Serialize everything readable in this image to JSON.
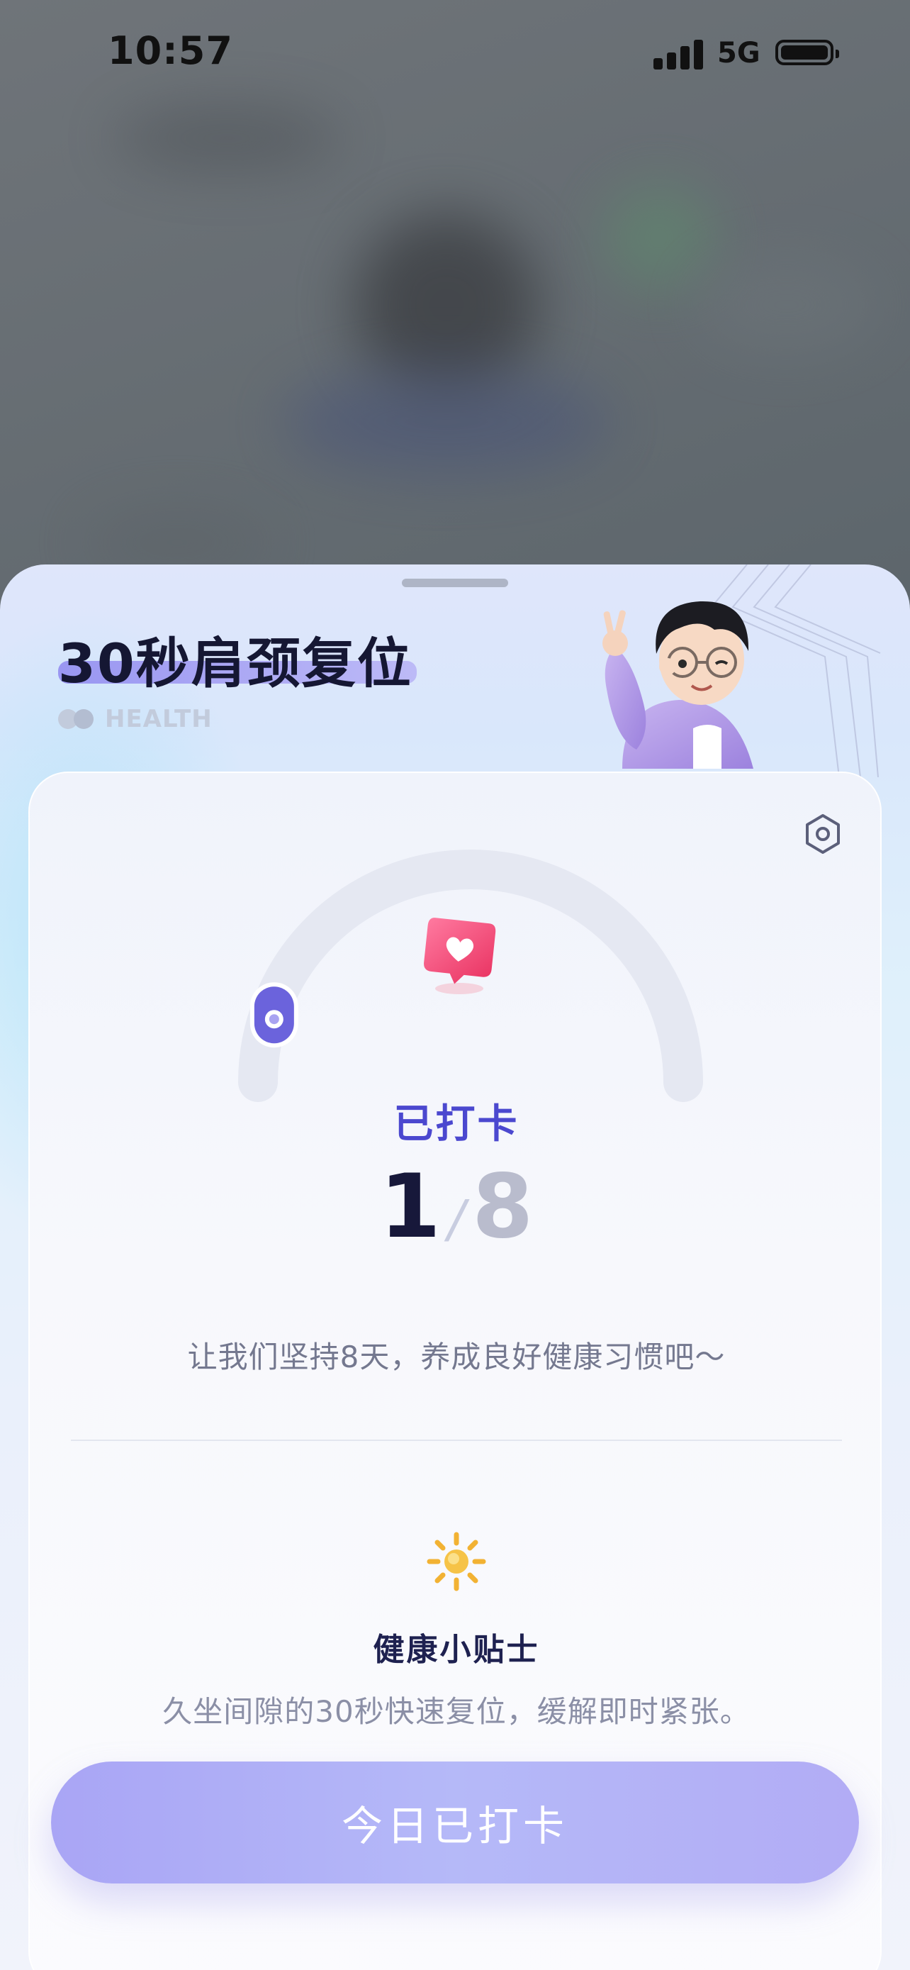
{
  "status_bar": {
    "time": "10:57",
    "network": "5G"
  },
  "sheet": {
    "title": "30秒肩颈复位",
    "brand_text": "HEALTH"
  },
  "card": {
    "status_label": "已打卡",
    "progress": {
      "done": "1",
      "separator": "/",
      "total": "8",
      "fraction": 0.125
    },
    "encourage": "让我们坚持8天，养成良好健康习惯吧～",
    "tips": {
      "title": "健康小贴士",
      "body": "久坐间隙的30秒快速复位，缓解即时紧张。"
    },
    "checkin_button": "今日已打卡"
  },
  "icons": [
    "settings-icon",
    "heart-bubble-icon",
    "sun-icon",
    "health-logo-icon",
    "mascot-image"
  ],
  "colors": {
    "accent": "#4b48cf",
    "button": "#aaa7f5",
    "title_text": "#151733"
  }
}
